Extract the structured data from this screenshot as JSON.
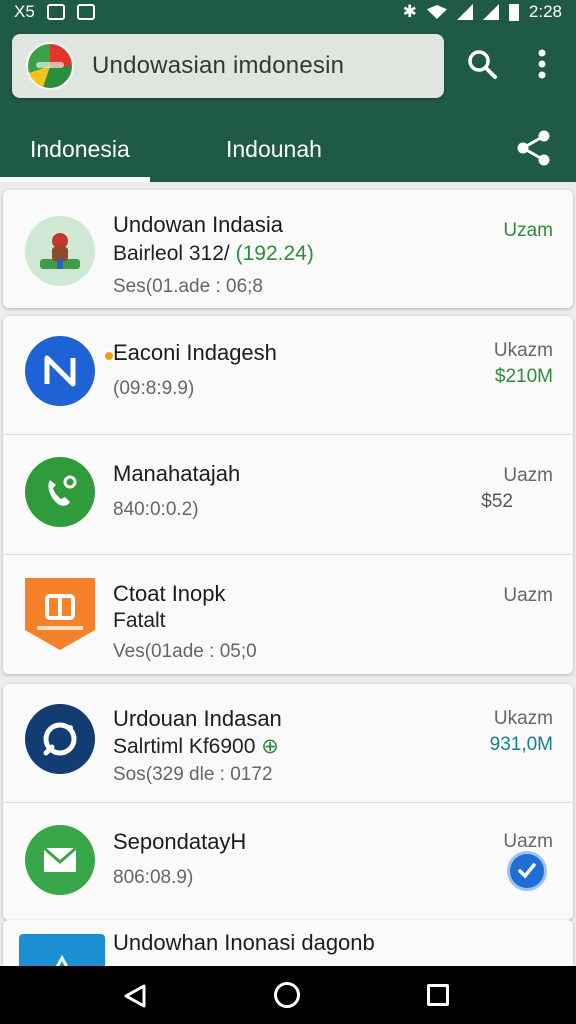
{
  "status_bar": {
    "time": "2:28",
    "left_text": "X5"
  },
  "search": {
    "text": "Undowasian imdonesin"
  },
  "tabs": [
    {
      "label": "Indonesia"
    },
    {
      "label": "Indounah"
    }
  ],
  "apps": [
    {
      "name": "Undowan Indasia",
      "sub": "Bairleol 312/",
      "sub_accent": "(192.24)",
      "meta": "Ses(01.ade : 06;8",
      "label": "Uzam",
      "label_color": "#2e8b3a",
      "icon": "person-illustration-icon"
    },
    {
      "name": "Eaconi Indagesh",
      "meta": "(09:8:9.9)",
      "label": "Ukazm",
      "value": "$210M",
      "value_color": "#2e8b3a",
      "icon": "n-logo-icon"
    },
    {
      "name": "Manahatajah",
      "meta": "840:0:0.2)",
      "label": "Uazm",
      "value": "$52",
      "value_color": "#555555",
      "icon": "phone-icon"
    },
    {
      "name": "Ctoat Inopk",
      "sub": "Fatalt",
      "meta": "Ves(01ade : 05;0",
      "label": "Uazm",
      "icon": "shield-a-icon"
    },
    {
      "name": "Urdouan Indasan",
      "sub": "Salrtiml Kf6900",
      "meta": "Sos(329 dle : 0172",
      "label": "Ukazm",
      "value": "931,0M",
      "value_color": "#17808e",
      "icon": "circle-logo-icon"
    },
    {
      "name": "SepondatayH",
      "meta": "806:08.9)",
      "label": "Uazm",
      "icon": "mail-icon"
    },
    {
      "name": "Undowhan Inonasi dagonb",
      "icon": "arrow-icon"
    }
  ]
}
